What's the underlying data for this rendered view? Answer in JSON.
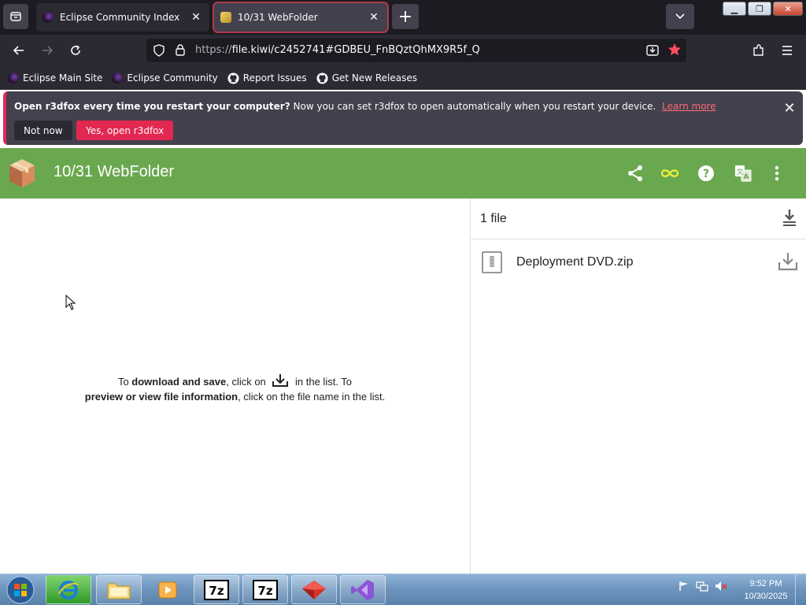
{
  "tabs": [
    {
      "title": "Eclipse Community Index",
      "favicon_color": "#5b2a86",
      "active": false
    },
    {
      "title": "10/31 WebFolder",
      "favicon_color": "#e3c24a",
      "active": true
    }
  ],
  "navbar": {
    "url_scheme": "https://",
    "url_rest": "file.kiwi/c2452741#GDBEU_FnBQztQhMX9R5f_Q"
  },
  "bookmarks": [
    {
      "label": "Eclipse Main Site",
      "icon": "eclipse-icon"
    },
    {
      "label": "Eclipse Community",
      "icon": "eclipse-icon"
    },
    {
      "label": "Report Issues",
      "icon": "github-icon"
    },
    {
      "label": "Get New Releases",
      "icon": "github-icon"
    }
  ],
  "notification": {
    "bold": "Open r3dfox every time you restart your computer?",
    "text": "Now you can set r3dfox to open automatically when you restart your device.",
    "learn_more": "Learn more",
    "not_now": "Not now",
    "yes": "Yes, open r3dfox"
  },
  "app": {
    "title": "10/31 WebFolder",
    "accent": "#6aa84f"
  },
  "instructions": {
    "part1": "To ",
    "bold1": "download and save",
    "part2": ", click on ",
    "part3": " in the list. To",
    "bold2": "preview or view file information",
    "part4": ", click on the file name in the list."
  },
  "files": {
    "count_label": "1 file",
    "items": [
      {
        "name": "Deployment DVD.zip"
      }
    ]
  },
  "taskbar": {
    "apps": [
      "internet-explorer",
      "file-explorer",
      "media-player",
      "7zip",
      "7zip",
      "toolbox",
      "visual-studio"
    ],
    "time": "9:52 PM",
    "date": "10/30/2025"
  }
}
